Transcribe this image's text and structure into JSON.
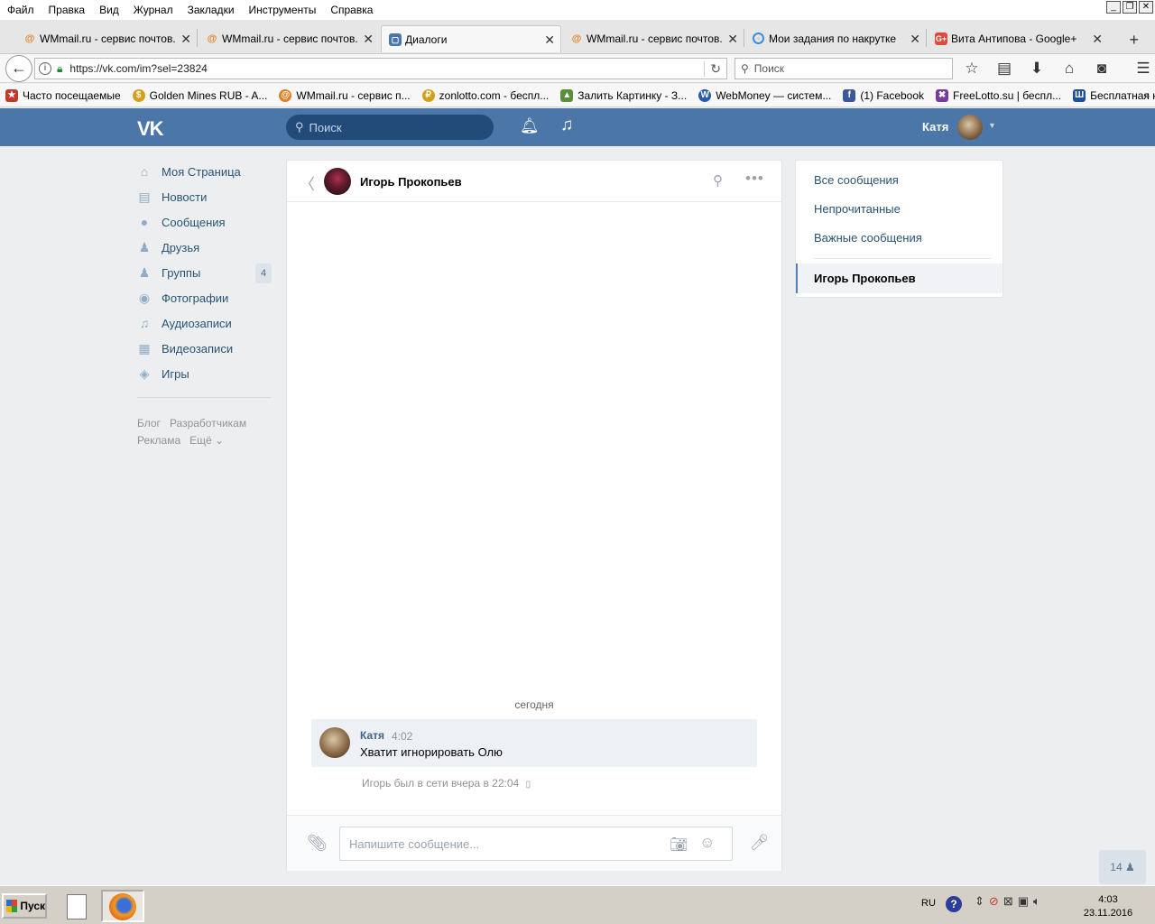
{
  "menubar": {
    "items": [
      "Файл",
      "Правка",
      "Вид",
      "Журнал",
      "Закладки",
      "Инструменты",
      "Справка"
    ]
  },
  "tabs": [
    {
      "title": "WMmail.ru - сервис почтов...",
      "icon": "wmmail-icon",
      "active": false
    },
    {
      "title": "WMmail.ru - сервис почтов...",
      "icon": "wmmail-icon",
      "active": false
    },
    {
      "title": "Диалоги",
      "icon": "vk-dialog-icon",
      "active": true
    },
    {
      "title": "WMmail.ru - сервис почтов...",
      "icon": "wmmail-icon",
      "active": false
    },
    {
      "title": "Мои задания по накрутке",
      "icon": "target-icon",
      "active": false
    },
    {
      "title": "Вита Антипова - Google+",
      "icon": "google-plus-icon",
      "active": false
    }
  ],
  "navbar": {
    "url": "https://vk.com/im?sel=23824",
    "search_placeholder": "Поиск"
  },
  "bookmarks": [
    {
      "label": "Часто посещаемые",
      "color": "#c0392b"
    },
    {
      "label": "Golden Mines RUB - A...",
      "color": "#d4a017"
    },
    {
      "label": "WMmail.ru - сервис п...",
      "color": "#e67e22"
    },
    {
      "label": "zonlotto.com - беспл...",
      "color": "#d4a017"
    },
    {
      "label": "Залить Картинку - З...",
      "color": "#5a8f3c"
    },
    {
      "label": "WebMoney — систем...",
      "color": "#2a5bb0"
    },
    {
      "label": "(1) Facebook",
      "color": "#3b5998"
    },
    {
      "label": "FreeLotto.su | беспл...",
      "color": "#7a3aa0"
    },
    {
      "label": "Бесплатная консуль...",
      "color": "#1f4f9a"
    }
  ],
  "vk": {
    "search_placeholder": "Поиск",
    "user_name": "Катя",
    "nav": [
      {
        "label": "Моя Страница",
        "icon": "home-icon",
        "glyph": "⌂"
      },
      {
        "label": "Новости",
        "icon": "news-icon",
        "glyph": "▤"
      },
      {
        "label": "Сообщения",
        "icon": "messages-icon",
        "glyph": "●"
      },
      {
        "label": "Друзья",
        "icon": "friends-icon",
        "glyph": "♟"
      },
      {
        "label": "Группы",
        "icon": "groups-icon",
        "glyph": "♟",
        "badge": "4"
      },
      {
        "label": "Фотографии",
        "icon": "photos-icon",
        "glyph": "◉"
      },
      {
        "label": "Аудиозаписи",
        "icon": "audio-icon",
        "glyph": "♫"
      },
      {
        "label": "Видеозаписи",
        "icon": "video-icon",
        "glyph": "▦"
      },
      {
        "label": "Игры",
        "icon": "games-icon",
        "glyph": "◈"
      }
    ],
    "footer": {
      "blog": "Блог",
      "dev": "Разработчикам",
      "ads": "Реклама",
      "more": "Ещё ⌄"
    },
    "dialog": {
      "peer_name": "Игорь Прокопьев",
      "date_divider": "сегодня",
      "message": {
        "author": "Катя",
        "time": "4:02",
        "text": "Хватит игнорировать Олю"
      },
      "last_seen": "Игорь был в сети вчера в 22:04",
      "input_placeholder": "Напишите сообщение..."
    },
    "filters": {
      "all": "Все сообщения",
      "unread": "Непрочитанные",
      "important": "Важные сообщения",
      "active_dialog": "Игорь Прокопьев"
    },
    "online_count": "14"
  },
  "taskbar": {
    "start": "Пуск",
    "lang": "RU",
    "time": "4:03",
    "date": "23.11.2016"
  }
}
